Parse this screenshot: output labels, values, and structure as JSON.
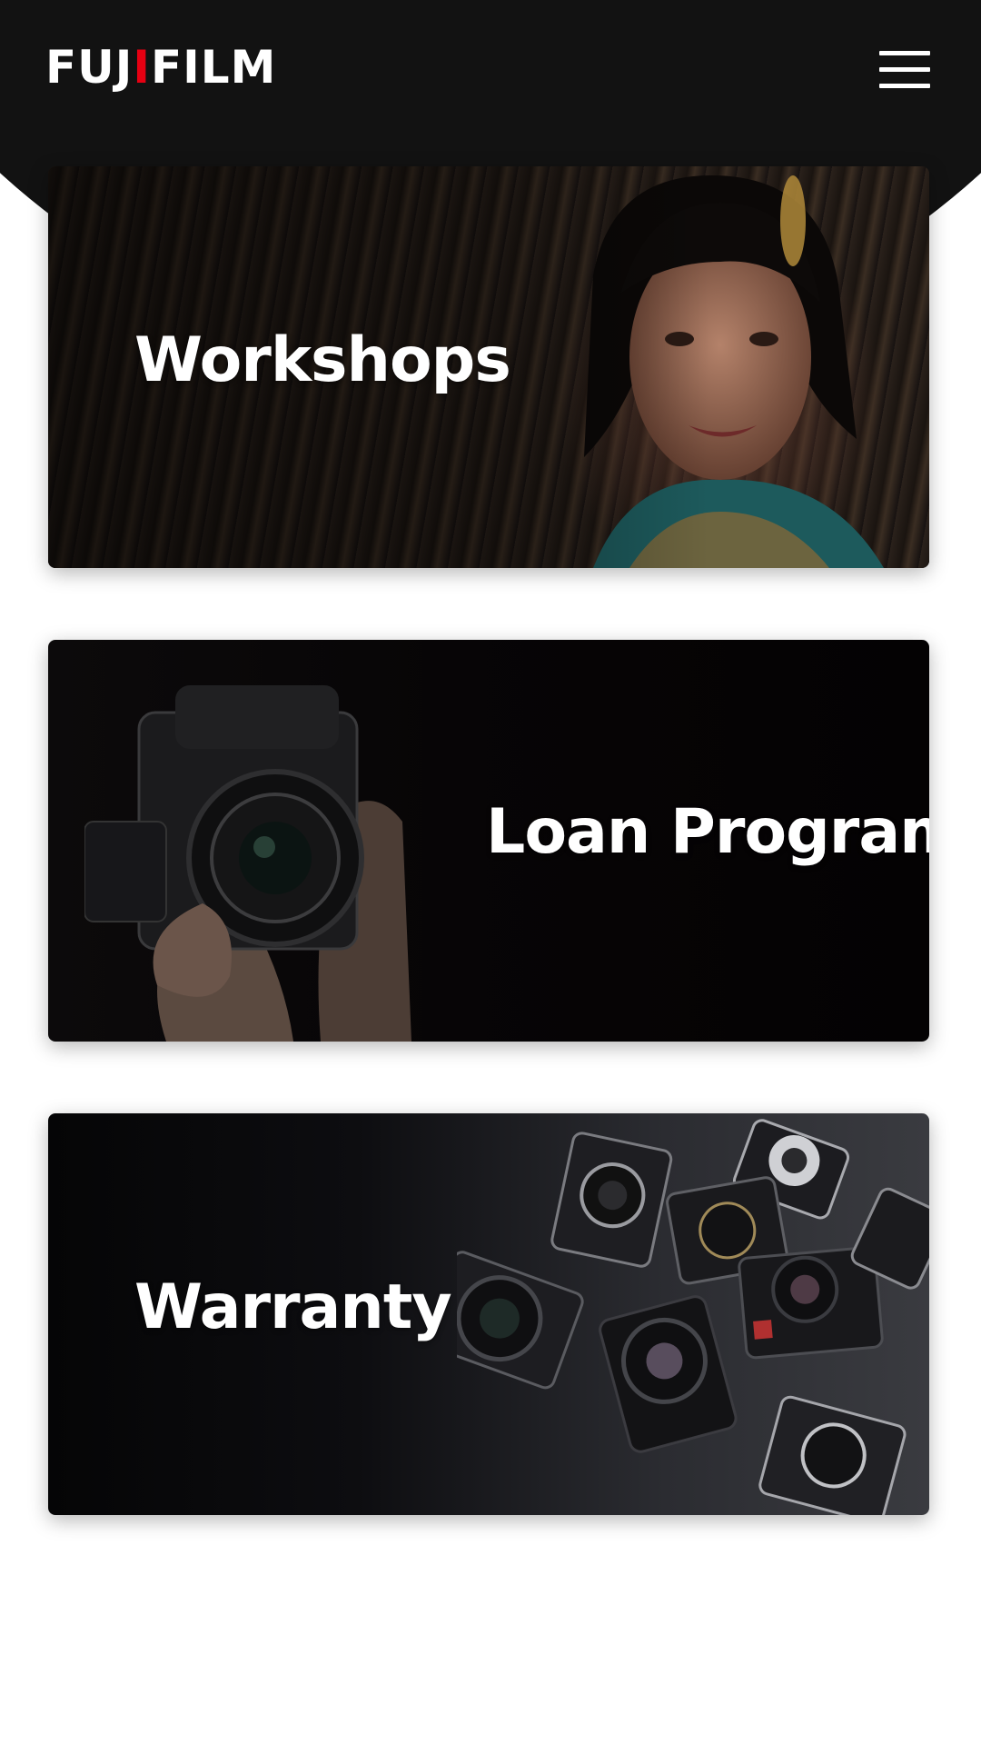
{
  "header": {
    "logo_text_a": "FUJ",
    "logo_text_i": "I",
    "logo_text_b": "FILM",
    "menu_icon": "hamburger-menu-icon"
  },
  "cards": [
    {
      "title": "Workshops"
    },
    {
      "title": "Loan Program"
    },
    {
      "title": "Warranty"
    }
  ],
  "colors": {
    "header_bg": "#121212",
    "brand_red": "#e60012",
    "card_text": "#ffffff"
  }
}
